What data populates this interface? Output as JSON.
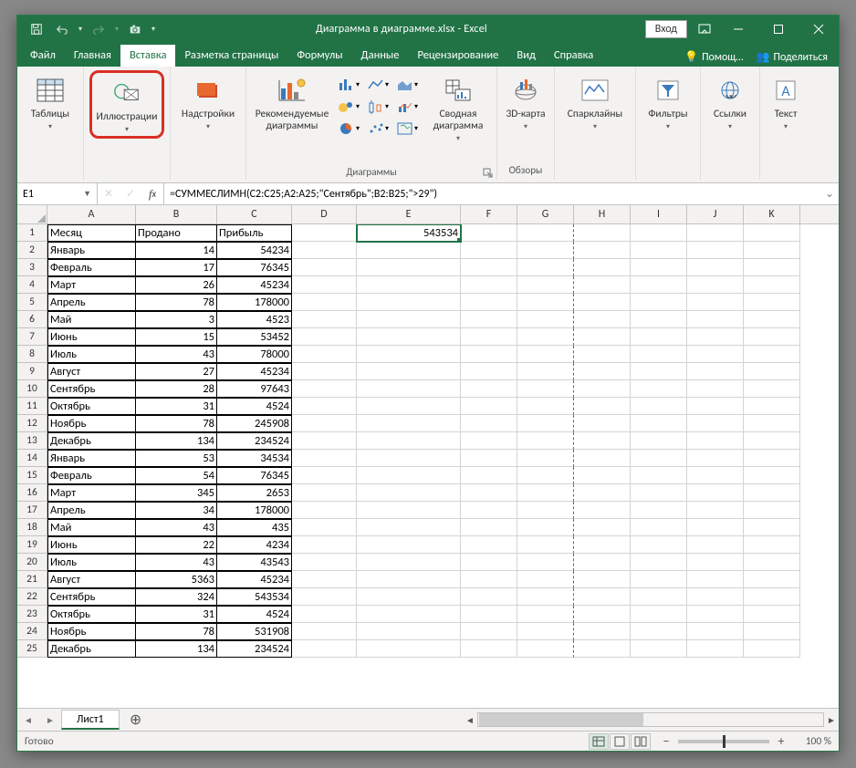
{
  "title": {
    "doc": "Диаграмма в диаграмме.xlsx",
    "app": "Excel",
    "sep": "  -  "
  },
  "titlebar": {
    "login": "Вход"
  },
  "tabs": [
    "Файл",
    "Главная",
    "Вставка",
    "Разметка страницы",
    "Формулы",
    "Данные",
    "Рецензирование",
    "Вид",
    "Справка"
  ],
  "active_tab": 2,
  "help": {
    "q": "Помощ…",
    "share": "Поделиться"
  },
  "ribbon": {
    "tables": "Таблицы",
    "illustr": "Иллюстрации",
    "addins": "Надстройки",
    "rec_charts": "Рекомендуемые диаграммы",
    "charts_group": "Диаграммы",
    "pivotchart": "Сводная диаграмма",
    "map3d": "3D-карта",
    "tours_group": "Обзоры",
    "spark": "Спарклайны",
    "filters": "Фильтры",
    "links": "Ссылки",
    "text": "Текст"
  },
  "fbar": {
    "cellref": "E1",
    "formula": "=СУММЕСЛИМН(C2:C25;A2:A25;\"Сентябрь\";B2:B25;\">29\")"
  },
  "cols": [
    "A",
    "B",
    "C",
    "D",
    "E",
    "F",
    "G",
    "H",
    "I",
    "J",
    "K"
  ],
  "rows": 25,
  "headers": {
    "A": "Месяц",
    "B": "Продано",
    "C": "Прибыль"
  },
  "tabledata": [
    [
      "Январь",
      14,
      54234
    ],
    [
      "Февраль",
      17,
      76345
    ],
    [
      "Март",
      26,
      45234
    ],
    [
      "Апрель",
      78,
      178000
    ],
    [
      "Май",
      3,
      4523
    ],
    [
      "Июнь",
      15,
      53452
    ],
    [
      "Июль",
      43,
      78000
    ],
    [
      "Август",
      27,
      45234
    ],
    [
      "Сентябрь",
      28,
      97643
    ],
    [
      "Октябрь",
      31,
      4524
    ],
    [
      "Ноябрь",
      78,
      245908
    ],
    [
      "Декабрь",
      134,
      234524
    ],
    [
      "Январь",
      53,
      34534
    ],
    [
      "Февраль",
      54,
      76345
    ],
    [
      "Март",
      345,
      2653
    ],
    [
      "Апрель",
      34,
      178000
    ],
    [
      "Май",
      43,
      435
    ],
    [
      "Июнь",
      22,
      4234
    ],
    [
      "Июль",
      43,
      43543
    ],
    [
      "Август",
      5363,
      45234
    ],
    [
      "Сентябрь",
      324,
      543534
    ],
    [
      "Октябрь",
      31,
      4524
    ],
    [
      "Ноябрь",
      78,
      531908
    ],
    [
      "Декабрь",
      134,
      234524
    ]
  ],
  "E1": "543534",
  "sheet": {
    "name": "Лист1",
    "add": "+"
  },
  "status": {
    "ready": "Готово",
    "zoom": "100 %"
  }
}
